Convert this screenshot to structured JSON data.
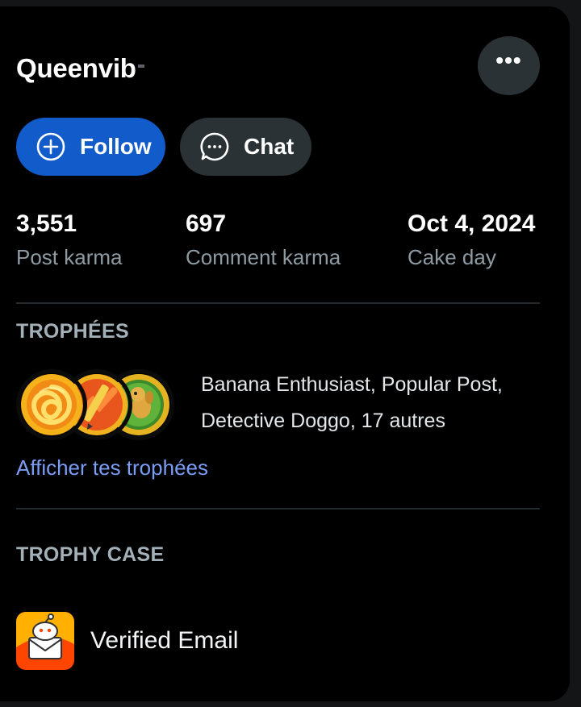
{
  "profile": {
    "username": "Queenvib"
  },
  "actions": {
    "more_label": "•••",
    "follow_label": "Follow",
    "chat_label": "Chat"
  },
  "stats": [
    {
      "value": "3,551",
      "label": "Post karma"
    },
    {
      "value": "697",
      "label": "Comment karma"
    },
    {
      "value": "Oct 4, 2024",
      "label": "Cake day"
    }
  ],
  "trophies": {
    "title": "TROPHÉES",
    "icons": [
      "banana-enthusiast-icon",
      "popular-post-icon",
      "detective-doggo-icon"
    ],
    "summary_line1": "Banana Enthusiast, Popular Post,",
    "summary_line2": "Detective Doggo, 17 autres",
    "link_label": "Afficher tes trophées"
  },
  "trophy_case": {
    "title": "TROPHY CASE",
    "items": [
      {
        "name": "Verified Email",
        "icon": "verified-email-icon"
      }
    ]
  },
  "colors": {
    "page_background": "#131517",
    "card_background": "#000000",
    "follow_button": "#115bca",
    "chat_button": "#2a3236",
    "link": "#7c9df5",
    "muted_text": "#8f9ba3"
  }
}
